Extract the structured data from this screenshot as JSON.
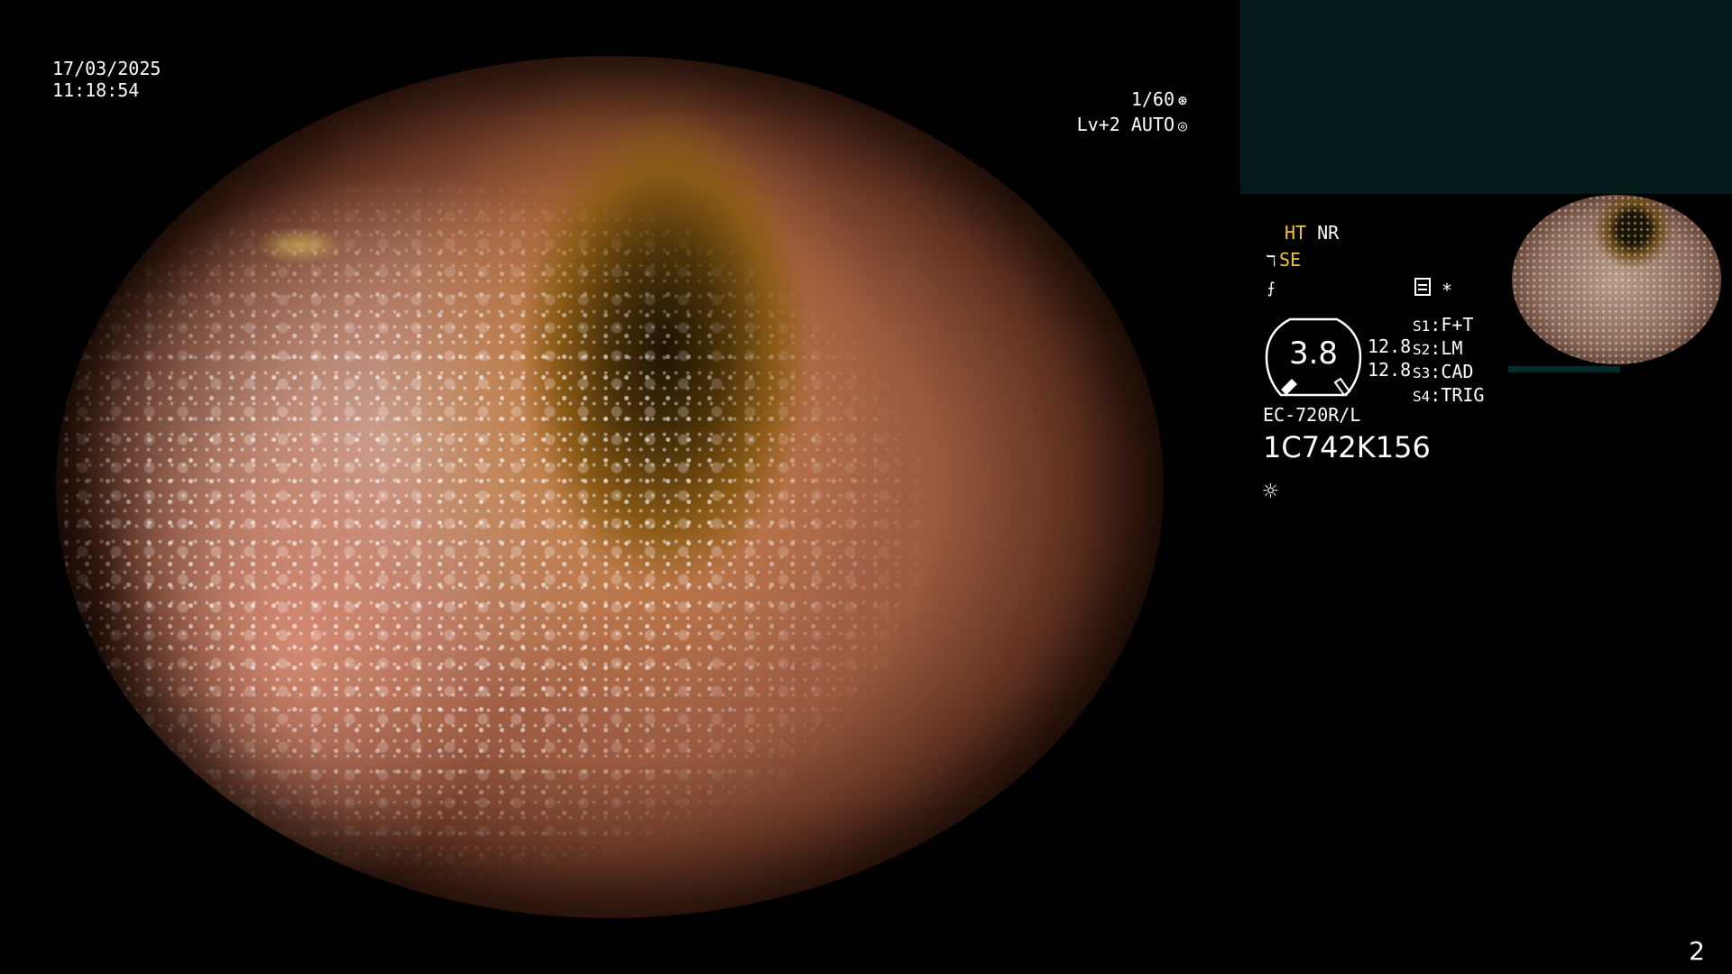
{
  "header": {
    "date": "17/03/2025",
    "time": "11:18:54"
  },
  "exposure": {
    "shutter": "1/60",
    "level": "Lv+2",
    "mode": "AUTO",
    "shutter_icon": "aperture-icon",
    "mode_icon": "auto-iris-icon"
  },
  "modes": {
    "ht": "HT",
    "nr": "NR",
    "se": "SE",
    "se_icon": "scope-icon",
    "freeze_icon": "freeze-icon",
    "menu_icon": "menu-list-icon",
    "asterisk": "*"
  },
  "gauge": {
    "value": "3.8",
    "top_reading": "12.8",
    "bottom_reading": "12.8"
  },
  "switches": [
    {
      "key": "S1",
      "value": "F+T"
    },
    {
      "key": "S2",
      "value": "LM"
    },
    {
      "key": "S3",
      "value": "CAD"
    },
    {
      "key": "S4",
      "value": "TRIG"
    }
  ],
  "scope": {
    "model": "EC-720R/L",
    "serial": "1C742K156",
    "light_icon": "light-source-icon"
  },
  "footer": {
    "page_number": "2"
  },
  "colors": {
    "highlight": "#f5c33a",
    "panel": "#03191a",
    "background": "#000000"
  }
}
